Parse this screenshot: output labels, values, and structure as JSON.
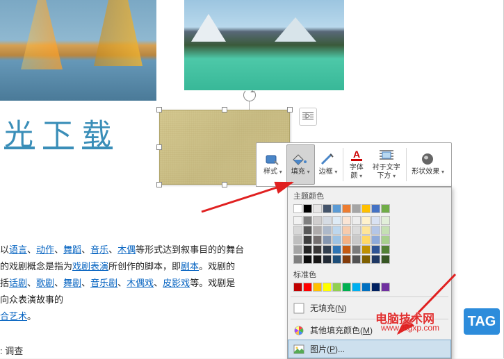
{
  "title_text": {
    "c1": "光",
    "c2": "下",
    "c3": "载"
  },
  "body": {
    "p1_pre": "以",
    "links1": [
      "语言",
      "动作",
      "舞蹈",
      "音乐",
      "木偶"
    ],
    "p1_suf": "等形式达到叙事目的的舞台",
    "p2_pre": "的戏剧概念是指为",
    "link2": "戏剧表演",
    "p2_mid": "所创作的脚本，即",
    "link2b": "剧本",
    "p2_suf": "。戏剧的",
    "p3_pre": "括",
    "links3": [
      "话剧",
      "歌剧",
      "舞剧",
      "音乐剧",
      "木偶戏",
      "皮影戏"
    ],
    "p3_suf": "等。戏剧是",
    "p4": "向众表演故事的",
    "link5": "合艺术",
    "p5_suf": "。"
  },
  "footer": ": 调查",
  "toolbar": {
    "style": "样式",
    "fill": "填充",
    "border": "边框",
    "font_color_l1": "字体",
    "font_color_l2": "颜",
    "text_wrap_l1": "衬于文字",
    "text_wrap_l2": "下方",
    "effect": "形状效果"
  },
  "dropdown": {
    "theme_header": "主题颜色",
    "standard_header": "标准色",
    "no_fill": "无填充(",
    "no_fill_u": "N",
    "no_fill_end": ")",
    "more": "其他填充颜色(",
    "more_u": "M",
    "more_end": ")",
    "picture": "图片(",
    "picture_u": "P",
    "picture_end": ")...",
    "theme_row1": [
      "#ffffff",
      "#000000",
      "#e7e6e6",
      "#44546a",
      "#5b9bd5",
      "#ed7d31",
      "#a5a5a5",
      "#ffc000",
      "#4472c4",
      "#70ad47"
    ],
    "theme_shades": [
      [
        "#f2f2f2",
        "#7f7f7f",
        "#d0cece",
        "#d6dce4",
        "#deebf6",
        "#fbe5d5",
        "#ededed",
        "#fff2cc",
        "#d9e2f3",
        "#e2efd9"
      ],
      [
        "#d8d8d8",
        "#595959",
        "#aeabab",
        "#adb9ca",
        "#bdd7ee",
        "#f7cbac",
        "#dbdbdb",
        "#fee599",
        "#b4c6e7",
        "#c5e0b3"
      ],
      [
        "#bfbfbf",
        "#3f3f3f",
        "#757070",
        "#8496b0",
        "#9cc3e5",
        "#f4b183",
        "#c9c9c9",
        "#ffd965",
        "#8eaadb",
        "#a8d08d"
      ],
      [
        "#a5a5a5",
        "#262626",
        "#3a3838",
        "#323f4f",
        "#2e75b5",
        "#c55a11",
        "#7b7b7b",
        "#bf9000",
        "#2f5496",
        "#538135"
      ],
      [
        "#7f7f7f",
        "#0c0c0c",
        "#171616",
        "#222a35",
        "#1e4e79",
        "#833c0b",
        "#525252",
        "#7f6000",
        "#1f3864",
        "#375623"
      ]
    ],
    "standard": [
      "#c00000",
      "#ff0000",
      "#ffc000",
      "#ffff00",
      "#92d050",
      "#00b050",
      "#00b0f0",
      "#0070c0",
      "#002060",
      "#7030a0"
    ]
  },
  "watermark": {
    "name": "电脑技术网",
    "url": "www.tagxp.com",
    "tag": "TAG"
  }
}
